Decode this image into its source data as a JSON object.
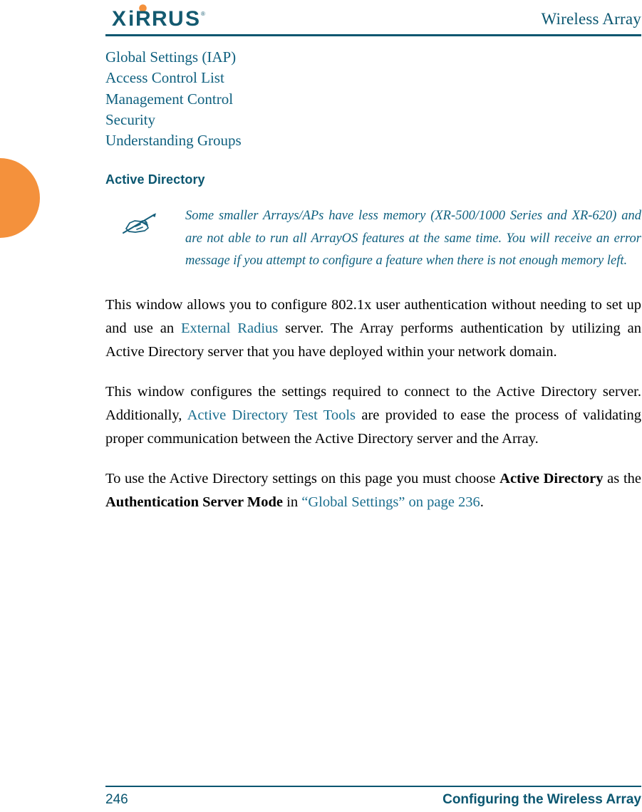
{
  "document": {
    "header": {
      "logo_text": "XIRRUS",
      "logo_trademark": "®",
      "title": "Wireless Array",
      "brand_color": "#0a5670",
      "accent_color": "#f4913c"
    },
    "nav_links": [
      {
        "label": "Global Settings (IAP)"
      },
      {
        "label": "Access Control List"
      },
      {
        "label": "Management Control"
      },
      {
        "label": "Security"
      },
      {
        "label": "Understanding Groups"
      }
    ],
    "section": {
      "heading": "Active Directory"
    },
    "note": {
      "icon": "writing-hand-note-icon",
      "text": "Some smaller Arrays/APs have less memory (XR-500/1000 Series and XR-620) and are not able to run all ArrayOS features at the same time. You will receive an error message if you attempt to configure a feature when there is not enough memory left.",
      "color": "#0f607f"
    },
    "paragraphs": [
      {
        "id": "p1",
        "segments": [
          {
            "type": "text",
            "value": "This window allows you to configure 802.1x user authentication without needing to set up and use an "
          },
          {
            "type": "link",
            "value": "External Radius"
          },
          {
            "type": "text",
            "value": " server. The Array performs authentication by utilizing an Active Directory server that you have deployed within your network domain."
          }
        ]
      },
      {
        "id": "p2",
        "segments": [
          {
            "type": "text",
            "value": "This window configures the settings required to connect to the Active Directory server. Additionally, "
          },
          {
            "type": "link",
            "value": "Active Directory Test Tools"
          },
          {
            "type": "text",
            "value": " are provided to ease the process of validating proper communication between the Active Directory server and the Array."
          }
        ]
      },
      {
        "id": "p3",
        "segments": [
          {
            "type": "text",
            "value": "To use the Active Directory settings on this page you must choose "
          },
          {
            "type": "bold",
            "value": "Active Directory"
          },
          {
            "type": "text",
            "value": " as the "
          },
          {
            "type": "bold",
            "value": "Authentication Server Mode"
          },
          {
            "type": "text",
            "value": " in "
          },
          {
            "type": "link",
            "value": "“Global Settings” on page 236"
          },
          {
            "type": "text",
            "value": "."
          }
        ]
      }
    ],
    "footer": {
      "page_number": "246",
      "label": "Configuring the Wireless Array"
    }
  }
}
